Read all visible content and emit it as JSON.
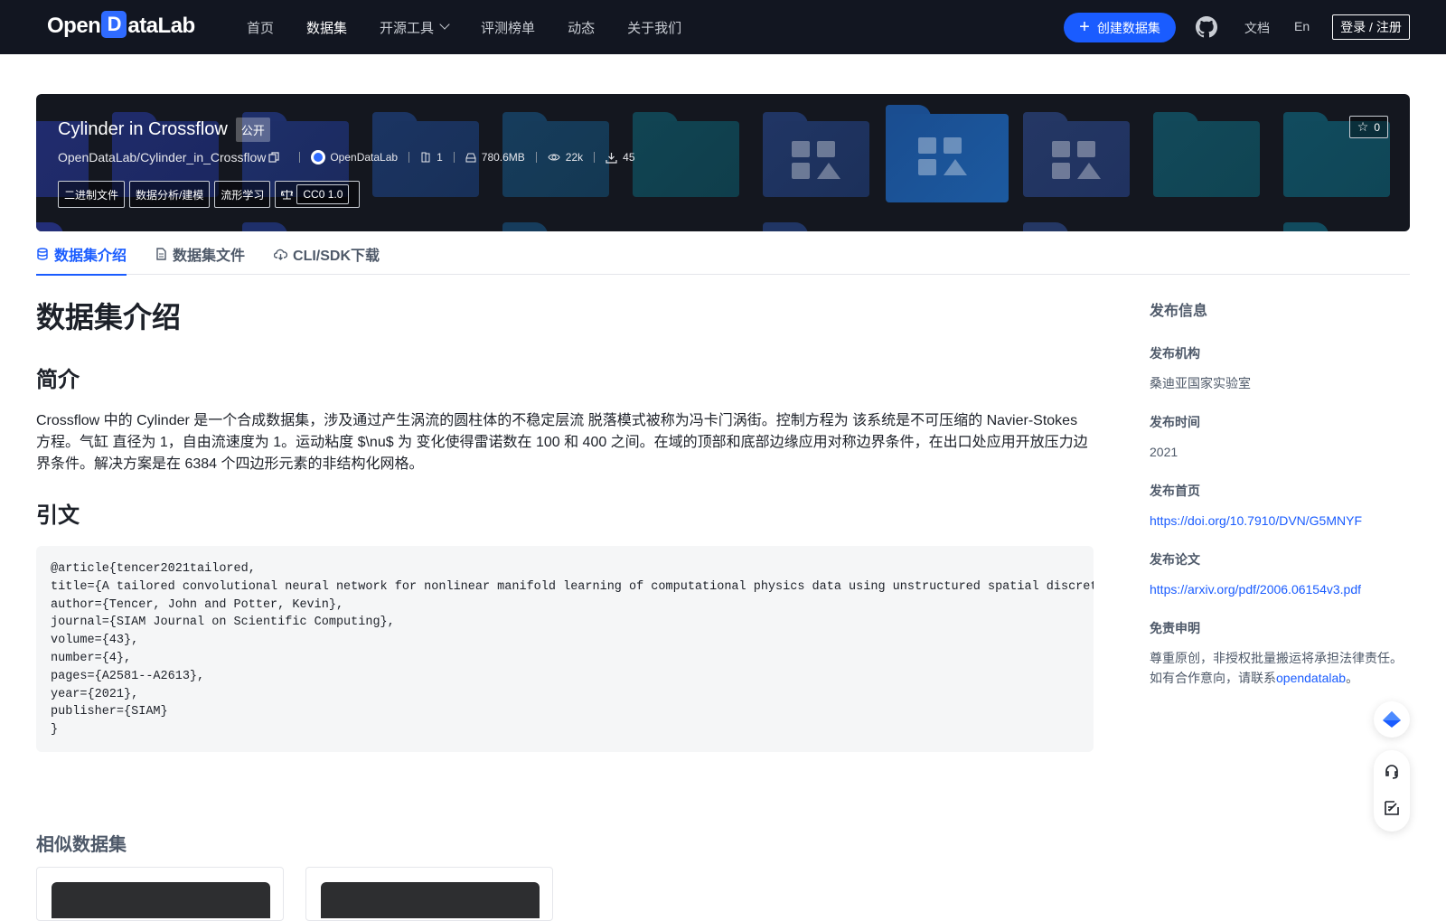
{
  "header": {
    "logo_text_left": "Open",
    "logo_text_d": "D",
    "logo_text_right": "ataLab",
    "nav": [
      {
        "label": "首页",
        "active": false
      },
      {
        "label": "数据集",
        "active": true
      },
      {
        "label": "开源工具",
        "active": false,
        "dropdown": true
      },
      {
        "label": "评测榜单",
        "active": false
      },
      {
        "label": "动态",
        "active": false
      },
      {
        "label": "关于我们",
        "active": false
      }
    ],
    "create_label": "创建数据集",
    "docs_label": "文档",
    "lang_label": "En",
    "login_label": "登录 / 注册"
  },
  "hero": {
    "title": "Cylinder in Crossflow",
    "visibility": "公开",
    "repo": "OpenDataLab/Cylinder_in_Crossflow",
    "org": "OpenDataLab",
    "file_count": "1",
    "size": "780.6MB",
    "views": "22k",
    "downloads": "45",
    "tags": [
      "二进制文件",
      "数据分析/建模",
      "流形学习"
    ],
    "license": "CC0 1.0",
    "stars": "0"
  },
  "tabs": [
    {
      "label": "数据集介绍",
      "active": true
    },
    {
      "label": "数据集文件",
      "active": false
    },
    {
      "label": "CLI/SDK下载",
      "active": false
    }
  ],
  "main": {
    "heading": "数据集介绍",
    "intro_heading": "简介",
    "intro_text": "Crossflow 中的 Cylinder 是一个合成数据集，涉及通过产生涡流的圆柱体的不稳定层流 脱落模式被称为冯卡门涡街。控制方程为 该系统是不可压缩的 Navier-Stokes 方程。气缸 直径为 1，自由流速度为 1。运动粘度 $\\nu$ 为 变化使得雷诺数在 100 和 400 之间。在域的顶部和底部边缘应用对称边界条件，在出口处应用开放压力边界条件。解决方案是在 6384 个四边形元素的非结构化网格。",
    "citation_heading": "引文",
    "citation": "@article{tencer2021tailored,\ntitle={A tailored convolutional neural network for nonlinear manifold learning of computational physics data using unstructured spatial discretizations},\nauthor={Tencer, John and Potter, Kevin},\njournal={SIAM Journal on Scientific Computing},\nvolume={43},\nnumber={4},\npages={A2581--A2613},\nyear={2021},\npublisher={SIAM}\n}",
    "similar_heading": "相似数据集"
  },
  "sidebar": {
    "title": "发布信息",
    "org_label": "发布机构",
    "org_value": "桑迪亚国家实验室",
    "time_label": "发布时间",
    "time_value": "2021",
    "homepage_label": "发布首页",
    "homepage_value": "https://doi.org/10.7910/DVN/G5MNYF",
    "paper_label": "发布论文",
    "paper_value": "https://arxiv.org/pdf/2006.06154v3.pdf",
    "disclaimer_label": "免责申明",
    "disclaimer_line1": "尊重原创，非授权批量搬运将承担法律责任。",
    "disclaimer_line2_prefix": "如有合作意向，请联系",
    "disclaimer_link": "opendatalab",
    "disclaimer_suffix": "。"
  },
  "colors": {
    "accent": "#1a5cff",
    "header_bg": "#121621",
    "hero_bg": "#14171f"
  },
  "icons": {
    "nav_dropdown": "chevron-down-icon",
    "create": "plus-icon",
    "github": "github-icon",
    "copy": "copy-icon",
    "files": "file-count-icon",
    "size": "disk-icon",
    "views": "eye-icon",
    "downloads": "download-icon",
    "license": "scale-icon",
    "star": "star-icon",
    "tab_intro": "database-icon",
    "tab_files": "document-icon",
    "tab_cli": "cloud-icon",
    "float_top": "feather-icon",
    "float_support": "headset-icon",
    "float_feedback": "edit-icon"
  }
}
